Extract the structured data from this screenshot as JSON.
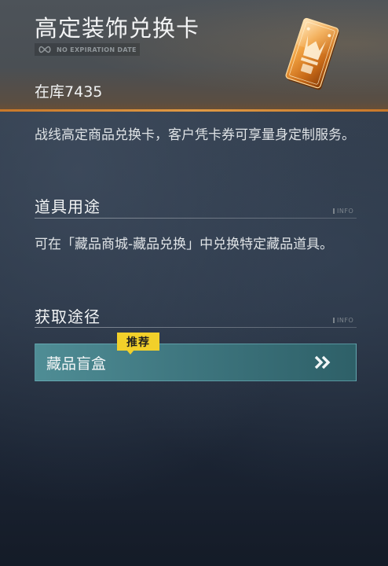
{
  "item": {
    "title": "高定装饰兑换卡",
    "expiry_label": "NO EXPIRATION DATE",
    "stock_label": "在库",
    "stock_count": "7435",
    "description": "战线高定商品兑换卡，客户凭卡券可享量身定制服务。"
  },
  "usage": {
    "title": "道具用途",
    "tag": "INFO",
    "text": "可在「藏品商城-藏品兑换」中兑换特定藏品道具。"
  },
  "source": {
    "title": "获取途径",
    "tag": "INFO",
    "items": [
      {
        "label": "藏品盲盒",
        "badge": "推荐"
      }
    ]
  },
  "colors": {
    "accent_orange": "#c8782a",
    "button_teal": "#3f7780",
    "badge_yellow": "#f2d02a"
  },
  "icons": {
    "expiry": "infinity-icon",
    "item": "exchange-card-icon",
    "go": "double-chevron-right-icon"
  }
}
